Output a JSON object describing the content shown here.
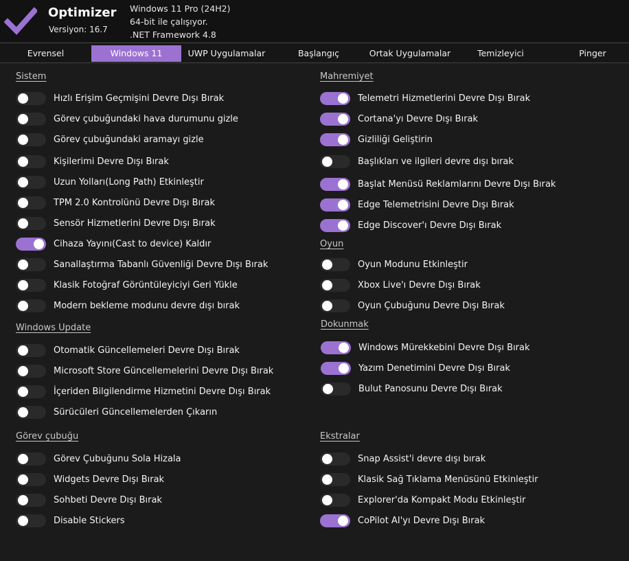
{
  "app": {
    "title": "Optimizer",
    "version": "Versiyon: 16.7",
    "os": "Windows 11 Pro (24H2)",
    "arch": "64-bit ile çalışıyor.",
    "framework": ".NET Framework 4.8",
    "logo_icon": "checkmark-icon",
    "accent": "#9b72d2"
  },
  "tabs": [
    "Evrensel",
    "Windows 11",
    "UWP Uygulamalar",
    "Başlangıç",
    "Ortak Uygulamalar",
    "Temizleyici",
    "Pinger"
  ],
  "active_tab": "Windows 11",
  "sections": {
    "sistem": {
      "title": "Sistem",
      "items": [
        {
          "label": "Hızlı Erişim Geçmişini Devre Dışı Bırak",
          "on": false
        },
        {
          "label": "Görev çubuğundaki hava durumunu gizle",
          "on": false
        },
        {
          "label": "Görev çubuğundaki aramayı gizle",
          "on": false
        },
        {
          "label": "Kişilerimi Devre Dışı Bırak",
          "on": false
        },
        {
          "label": "Uzun Yolları(Long Path) Etkinleştir",
          "on": false
        },
        {
          "label": "TPM 2.0 Kontrolünü Devre Dışı Bırak",
          "on": false
        },
        {
          "label": "Sensör Hizmetlerini Devre Dışı Bırak",
          "on": false
        },
        {
          "label": "Cihaza Yayını(Cast to device) Kaldır",
          "on": true
        },
        {
          "label": "Sanallaştırma Tabanlı Güvenliği Devre Dışı Bırak",
          "on": false
        },
        {
          "label": "Klasik Fotoğraf Görüntüleyiciyi Geri Yükle",
          "on": false
        },
        {
          "label": "Modern bekleme modunu devre dışı bırak",
          "on": false
        }
      ]
    },
    "windows_update": {
      "title": "Windows Update",
      "items": [
        {
          "label": "Otomatik Güncellemeleri Devre Dışı Bırak",
          "on": false
        },
        {
          "label": "Microsoft Store Güncellemelerini Devre Dışı Bırak",
          "on": false
        },
        {
          "label": "İçeriden Bilgilendirme Hizmetini Devre Dışı Bırak",
          "on": false
        },
        {
          "label": "Sürücüleri Güncellemelerden Çıkarın",
          "on": false
        }
      ]
    },
    "gorev_cubugu": {
      "title": "Görev çubuğu",
      "items": [
        {
          "label": "Görev Çubuğunu Sola Hizala",
          "on": false
        },
        {
          "label": "Widgets Devre Dışı Bırak",
          "on": false
        },
        {
          "label": "Sohbeti Devre Dışı Bırak",
          "on": false
        },
        {
          "label": "Disable Stickers",
          "on": false
        }
      ]
    },
    "mahremiyet": {
      "title": "Mahremiyet",
      "items": [
        {
          "label": "Telemetri Hizmetlerini Devre Dışı Bırak",
          "on": true
        },
        {
          "label": "Cortana'yı Devre Dışı Bırak",
          "on": true
        },
        {
          "label": "Gizliliği Geliştirin",
          "on": true
        },
        {
          "label": "Başlıkları ve ilgileri devre dışı bırak",
          "on": false
        },
        {
          "label": "Başlat Menüsü Reklamlarını Devre Dışı Bırak",
          "on": true
        },
        {
          "label": "Edge Telemetrisini Devre Dışı Bırak",
          "on": true
        },
        {
          "label": "Edge Discover'ı Devre Dışı Bırak",
          "on": true
        }
      ]
    },
    "oyun": {
      "title": "Oyun",
      "items": [
        {
          "label": "Oyun Modunu Etkinleştir",
          "on": false
        },
        {
          "label": "Xbox Live'ı Devre Dışı Bırak",
          "on": false
        },
        {
          "label": "Oyun Çubuğunu Devre Dışı Bırak",
          "on": false
        }
      ]
    },
    "dokunmak": {
      "title": "Dokunmak",
      "items": [
        {
          "label": "Windows Mürekkebini Devre Dışı Bırak",
          "on": true
        },
        {
          "label": "Yazım Denetimini Devre Dışı Bırak",
          "on": true
        },
        {
          "label": "Bulut Panosunu Devre Dışı Bırak",
          "on": false
        }
      ]
    },
    "ekstralar": {
      "title": "Ekstralar",
      "items": [
        {
          "label": "Snap Assist'i devre dışı bırak",
          "on": false
        },
        {
          "label": "Klasik Sağ Tıklama Menüsünü Etkinleştir",
          "on": false
        },
        {
          "label": "Explorer'da Kompakt Modu Etkinleştir",
          "on": false
        },
        {
          "label": "CoPilot AI'yı Devre Dışı Bırak",
          "on": true
        }
      ]
    }
  }
}
